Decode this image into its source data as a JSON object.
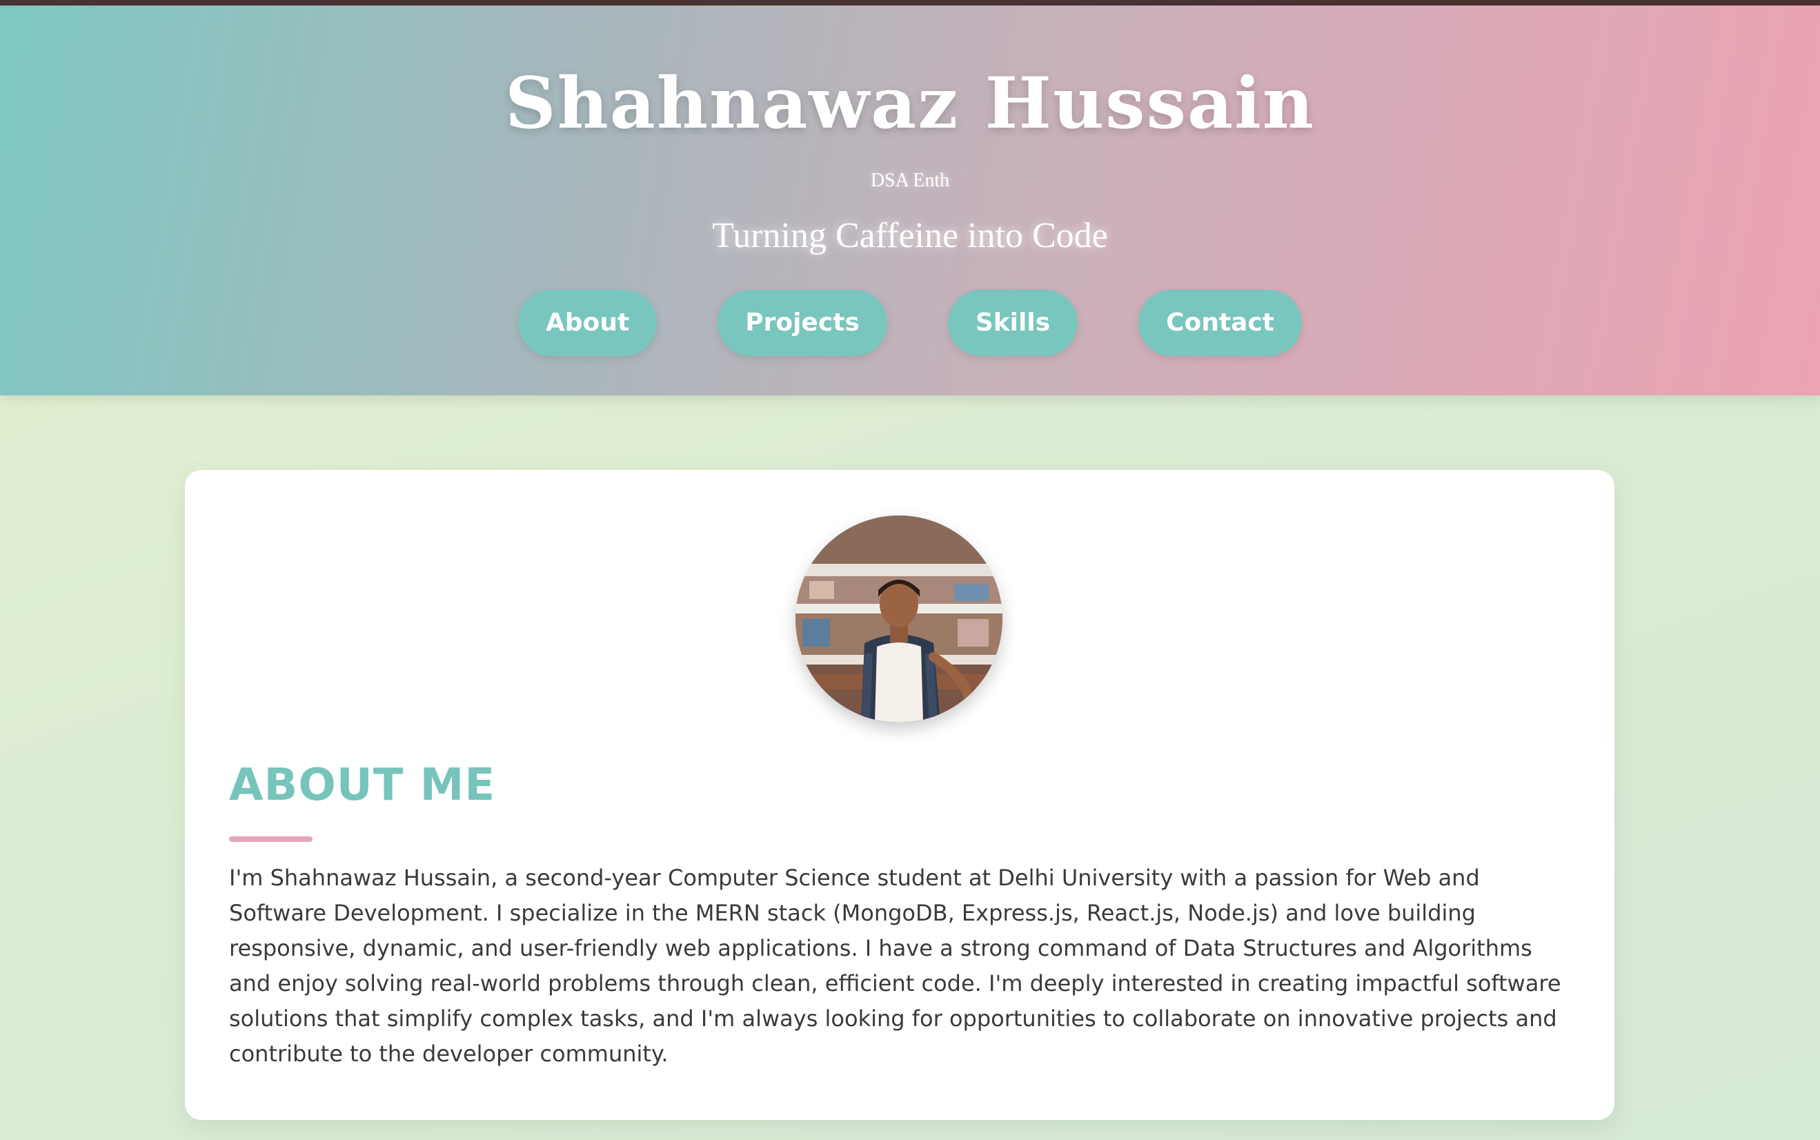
{
  "header": {
    "name": "Shahnawaz Hussain",
    "subtitle": "DSA Enth",
    "tagline": "Turning Caffeine into Code",
    "nav": [
      {
        "label": "About"
      },
      {
        "label": "Projects"
      },
      {
        "label": "Skills"
      },
      {
        "label": "Contact"
      }
    ]
  },
  "about": {
    "heading": "ABOUT ME",
    "body": "I'm Shahnawaz Hussain, a second-year Computer Science student at Delhi University with a passion for Web and Software Development. I specialize in the MERN stack (MongoDB, Express.js, React.js, Node.js) and love building responsive, dynamic, and user-friendly web applications. I have a strong command of Data Structures and Algorithms and enjoy solving real-world problems through clean, efficient code. I'm deeply interested in creating impactful software solutions that simplify complex tasks, and I'm always looking for opportunities to collaborate on innovative projects and contribute to the developer community."
  },
  "theme": {
    "accent_teal": "#78c6bd",
    "accent_pink": "#e3a7b8",
    "top_strip": "#4a3432",
    "text": "#3a3a3a"
  }
}
